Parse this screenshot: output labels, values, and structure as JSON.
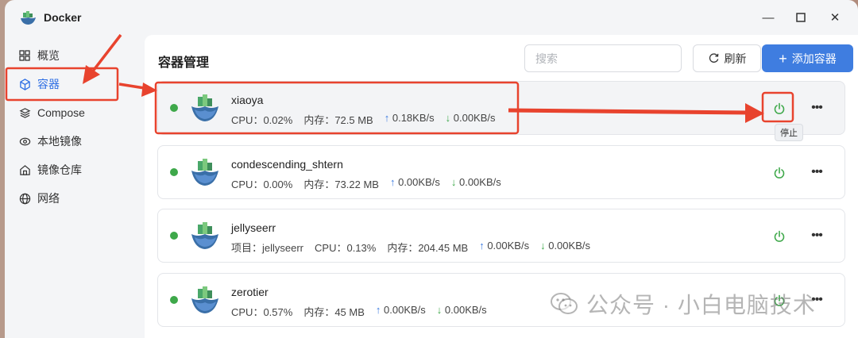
{
  "window": {
    "title": "Docker"
  },
  "sidebar": {
    "items": [
      {
        "label": "概览",
        "icon": "grid-icon"
      },
      {
        "label": "容器",
        "icon": "cube-icon",
        "active": true
      },
      {
        "label": "Compose",
        "icon": "layers-icon"
      },
      {
        "label": "本地镜像",
        "icon": "eye-icon"
      },
      {
        "label": "镜像仓库",
        "icon": "house-icon"
      },
      {
        "label": "网络",
        "icon": "globe-icon"
      }
    ]
  },
  "main": {
    "title": "容器管理",
    "search_placeholder": "搜索",
    "refresh_label": "刷新",
    "add_label": "添加容器"
  },
  "containers": [
    {
      "name": "xiaoya",
      "stats": [
        "CPU：0.02%",
        "内存：72.5 MB",
        "0.18KB/s",
        "0.00KB/s"
      ],
      "status": "running"
    },
    {
      "name": "condescending_shtern",
      "stats": [
        "CPU：0.00%",
        "内存：73.22 MB",
        "0.00KB/s",
        "0.00KB/s"
      ],
      "status": "running"
    },
    {
      "name": "jellyseerr",
      "project": "项目：jellyseerr",
      "stats": [
        "CPU：0.13%",
        "内存：204.45 MB",
        "0.00KB/s",
        "0.00KB/s"
      ],
      "status": "running"
    },
    {
      "name": "zerotier",
      "stats": [
        "CPU：0.57%",
        "内存：45 MB",
        "0.00KB/s",
        "0.00KB/s"
      ],
      "status": "running"
    }
  ],
  "tooltip": "停止",
  "watermark": "公众号 · 小白电脑技术",
  "colors": {
    "accent": "#3f7de0",
    "running": "#3ea84a",
    "annotation": "#e8432e"
  }
}
